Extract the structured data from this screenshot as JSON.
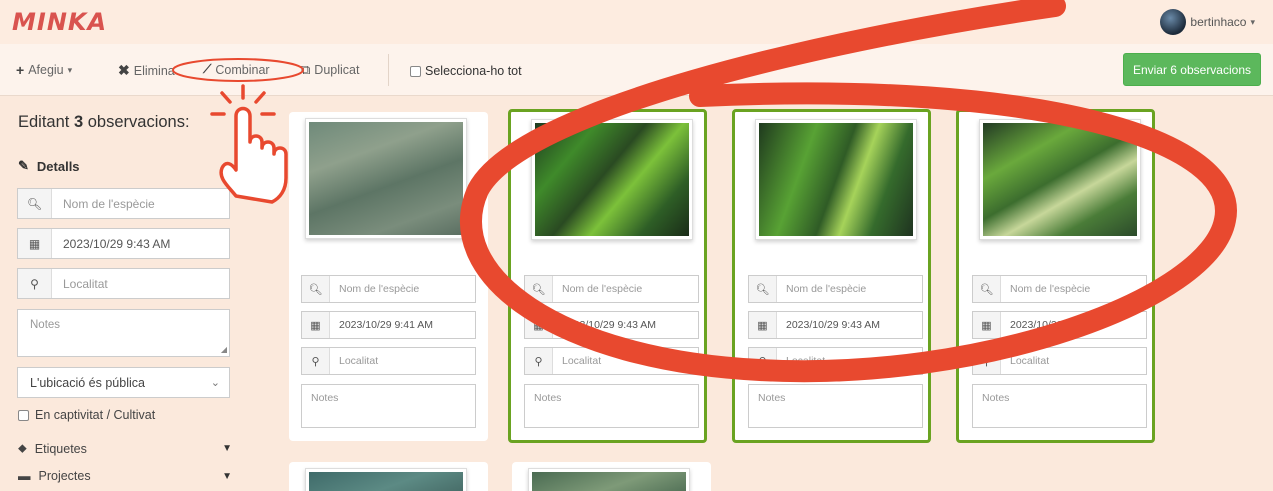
{
  "app": {
    "logo": "MINKA",
    "user": "bertinhaco"
  },
  "toolbar": {
    "add_label": "Afegiu",
    "delete_label": "Elimina",
    "combine_label": "Combinar",
    "duplicate_label": "Duplicat",
    "select_all_label": "Selecciona-ho tot",
    "send_label": "Enviar 6 observacions"
  },
  "sidebar": {
    "title_prefix": "Editant",
    "title_count": "3",
    "title_suffix": "observacions:",
    "details_label": "Detalls",
    "species_placeholder": "Nom de l'espècie",
    "date_value": "2023/10/29 9:43 AM",
    "location_placeholder": "Localitat",
    "notes_placeholder": "Notes",
    "privacy_value": "L'ubicació és pública",
    "captivity_label": "En captivitat / Cultivat",
    "tags_label": "Etiquetes",
    "projects_label": "Projectes"
  },
  "cards": [
    {
      "species_placeholder": "Nom de l'espècie",
      "date": "2023/10/29 9:41 AM",
      "location_placeholder": "Localitat",
      "notes_placeholder": "Notes",
      "selected": false
    },
    {
      "species_placeholder": "Nom de l'espècie",
      "date": "2023/10/29 9:43 AM",
      "location_placeholder": "Localitat",
      "notes_placeholder": "Notes",
      "selected": true
    },
    {
      "species_placeholder": "Nom de l'espècie",
      "date": "2023/10/29 9:43 AM",
      "location_placeholder": "Localitat",
      "notes_placeholder": "Notes",
      "selected": true
    },
    {
      "species_placeholder": "Nom de l'espècie",
      "date": "2023/10/29 9:43 AM",
      "location_placeholder": "Localitat",
      "notes_placeholder": "Notes",
      "selected": true
    }
  ],
  "colors": {
    "accent_green": "#5cb85c",
    "selected_border": "#6aa321",
    "logo_red": "#d9534f",
    "annotation_red": "#e8492f"
  },
  "icons": [
    "plus-icon",
    "times-icon",
    "magic-wand-icon",
    "duplicate-icon",
    "search-icon",
    "calendar-icon",
    "map-marker-icon",
    "pencil-icon",
    "tag-icon",
    "briefcase-icon",
    "hand-pointer-icon"
  ]
}
